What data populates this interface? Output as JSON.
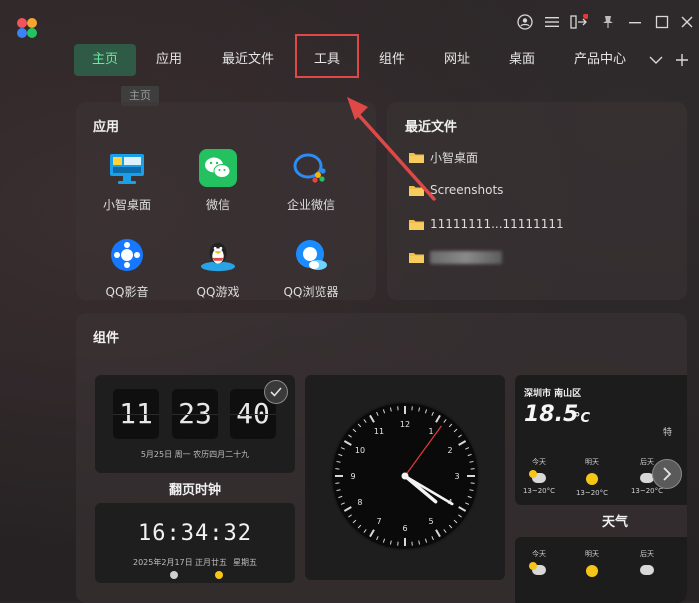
{
  "nav": {
    "tabs": [
      "主页",
      "应用",
      "最近文件",
      "工具",
      "组件",
      "网址",
      "桌面",
      "产品中心"
    ],
    "active_index": 0,
    "highlight_index": 3,
    "tooltip": "主页"
  },
  "apps_panel": {
    "title": "应用",
    "apps": [
      {
        "label": "小智桌面",
        "icon": "xiaozhi-desktop-icon"
      },
      {
        "label": "微信",
        "icon": "wechat-icon"
      },
      {
        "label": "企业微信",
        "icon": "wecom-icon"
      },
      {
        "label": "QQ影音",
        "icon": "qq-player-icon"
      },
      {
        "label": "QQ游戏",
        "icon": "qq-game-icon"
      },
      {
        "label": "QQ浏览器",
        "icon": "qq-browser-icon"
      }
    ]
  },
  "recent_panel": {
    "title": "最近文件",
    "files": [
      "小智桌面",
      "Screenshots",
      "11111111...11111111",
      ""
    ]
  },
  "widgets_panel": {
    "title": "组件",
    "flip_clock": {
      "hours": "11",
      "minutes": "23",
      "seconds": "40",
      "date_line": "5月25日  周一  农历四月二十九",
      "caption": "翻页时钟"
    },
    "digital_clock": {
      "time": "16:34:32",
      "date": "2025年2月17日",
      "lunar": "正月廿五",
      "weekday": "星期五"
    },
    "analog_clock": {
      "hour": 4,
      "minute": 20,
      "second": 6
    },
    "weather": {
      "location": "深圳市 南山区",
      "temperature": "18.5",
      "unit": "°C",
      "days": [
        {
          "name": "今天",
          "icon": "cloudy-sun-icon",
          "range": "13~20°C"
        },
        {
          "name": "明天",
          "icon": "sun-icon",
          "range": "13~20°C"
        },
        {
          "name": "后天",
          "icon": "cloudy-icon",
          "range": "13~20°C"
        }
      ],
      "caption": "天气",
      "partial_char": "特"
    },
    "weather2_days": [
      "今天",
      "明天",
      "后天"
    ]
  },
  "colors": {
    "accent_green": "#6ee7a2",
    "active_bg": "#2f5a45",
    "annotation_red": "#e04848"
  }
}
